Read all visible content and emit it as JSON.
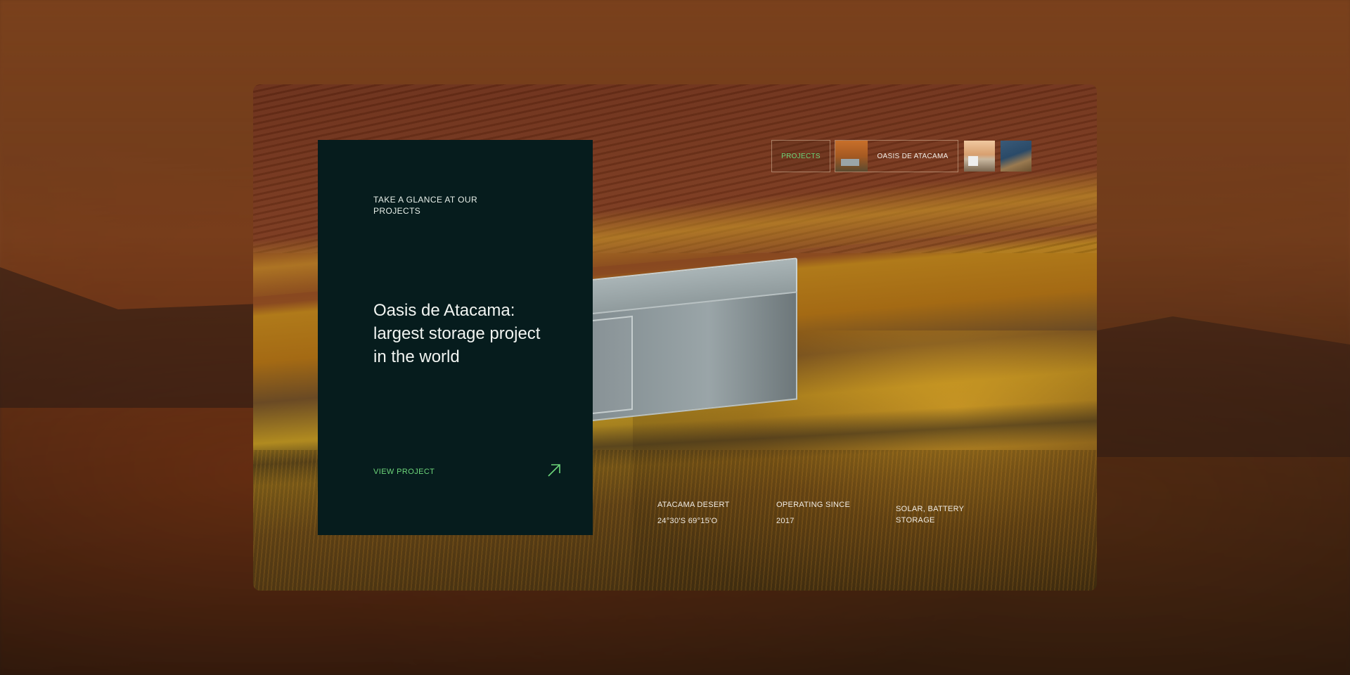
{
  "card": {
    "eyebrow": "TAKE A GLANCE AT OUR PROJECTS",
    "title": "Oasis de Atacama: largest storage project in the world",
    "view_project_label": "VIEW PROJECT",
    "arrow_icon": "arrow-up-right-icon"
  },
  "tabs": {
    "projects_label": "PROJECTS",
    "active_label": "OASIS DE ATACAMA",
    "thumbnail_count": 2
  },
  "info": {
    "location": "ATACAMA DESERT",
    "coordinates": "24°30'S 69°15'O",
    "operating_label": "OPERATING SINCE",
    "operating_year": "2017",
    "technology": "SOLAR, BATTERY STORAGE"
  },
  "colors": {
    "accent_green": "#6dd67a",
    "card_bg": "#061c1d"
  }
}
